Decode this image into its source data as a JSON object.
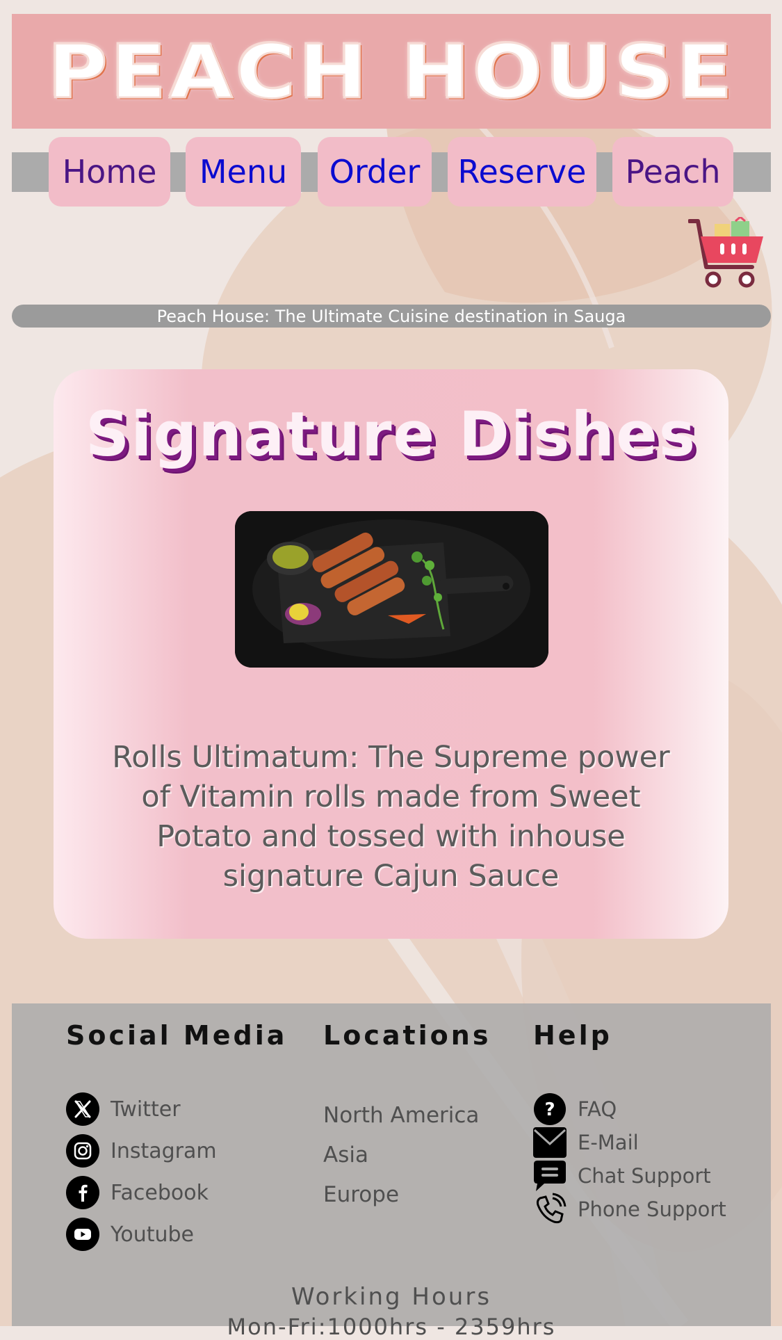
{
  "banner": {
    "title": "PEACH HOUSE"
  },
  "nav": {
    "items": [
      {
        "label": "Home",
        "state": "visited"
      },
      {
        "label": "Menu",
        "state": "link"
      },
      {
        "label": "Order",
        "state": "link"
      },
      {
        "label": "Reserve",
        "state": "link"
      },
      {
        "label": "Peach",
        "state": "visited"
      }
    ],
    "cart_icon": "shopping-cart-icon"
  },
  "tagline": "Peach House: The Ultimate Cuisine destination in Sauga",
  "signature": {
    "title": "Signature Dishes",
    "image": "sweet-potato-rolls-photo",
    "description": "Rolls Ultimatum: The Supreme power of Vitamin rolls made from Sweet Potato and tossed with inhouse signature Cajun Sauce"
  },
  "footer": {
    "social": {
      "title": "Social Media",
      "items": [
        {
          "label": "Twitter",
          "icon": "x-twitter-icon"
        },
        {
          "label": "Instagram",
          "icon": "instagram-icon"
        },
        {
          "label": "Facebook",
          "icon": "facebook-icon"
        },
        {
          "label": "Youtube",
          "icon": "youtube-icon"
        }
      ]
    },
    "locations": {
      "title": "Locations",
      "items": [
        "North America",
        "Asia",
        "Europe"
      ]
    },
    "help": {
      "title": "Help",
      "items": [
        {
          "label": "FAQ",
          "icon": "question-icon"
        },
        {
          "label": "E-Mail",
          "icon": "mail-icon"
        },
        {
          "label": "Chat Support",
          "icon": "chat-icon"
        },
        {
          "label": "Phone Support",
          "icon": "phone-icon"
        }
      ]
    },
    "hours": {
      "title": "Working Hours",
      "line": "Mon-Fri:1000hrs - 2359hrs"
    }
  },
  "colors": {
    "banner_bg": "#e9a9aa",
    "nav_bar": "#ababab",
    "nav_button": "#f2bcc8",
    "link": "#0b0bd0",
    "visited_link": "#4a1585",
    "card_pink": "#f2bfca",
    "title_shadow": "#7d1a80"
  }
}
